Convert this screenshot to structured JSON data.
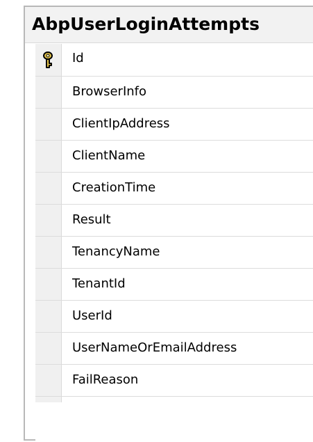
{
  "table": {
    "title": "AbpUserLoginAttempts",
    "columns": [
      {
        "name": "Id",
        "primary_key": true,
        "key_icon": "primary-key-icon"
      },
      {
        "name": "BrowserInfo"
      },
      {
        "name": "ClientIpAddress"
      },
      {
        "name": "ClientName"
      },
      {
        "name": "CreationTime"
      },
      {
        "name": "Result"
      },
      {
        "name": "TenancyName"
      },
      {
        "name": "TenantId"
      },
      {
        "name": "UserId"
      },
      {
        "name": "UserNameOrEmailAddress"
      },
      {
        "name": "FailReason"
      }
    ]
  },
  "colors": {
    "title_background": "#f2f2f2",
    "selector_background": "#f0f0f0",
    "row_border": "#dcdcdc",
    "window_border": "#b8b8b8",
    "key_gold": "#e3c34a"
  }
}
